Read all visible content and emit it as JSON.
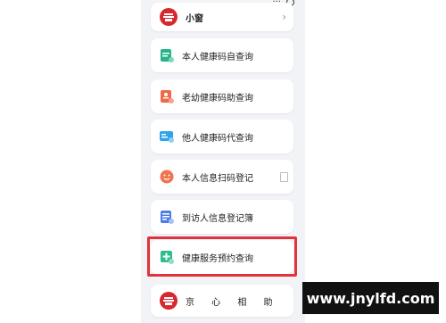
{
  "top_item": {
    "label": "小窗",
    "chevron": "›"
  },
  "menu_items": [
    {
      "label": "本人健康码自查询",
      "icon": "doc-check-icon",
      "color": "#27b38a"
    },
    {
      "label": "老幼健康码助查询",
      "icon": "doc-person-icon",
      "color": "#ee6a4b"
    },
    {
      "label": "他人健康码代查询",
      "icon": "id-card-icon",
      "color": "#2fa4e7"
    },
    {
      "label": "本人信息扫码登记",
      "icon": "smile-icon",
      "color": "#f0744f"
    },
    {
      "label": "到访人信息登记簿",
      "icon": "list-icon",
      "color": "#4d7ce8"
    },
    {
      "label": "健康服务预约查询",
      "icon": "plus-calendar-icon",
      "color": "#2bbd8c"
    }
  ],
  "bottom_item": {
    "label": "京 心 相 助"
  },
  "watermark": "www.jnylfd.com",
  "colors": {
    "highlight": "#e2323b",
    "panel_bg": "#f1f3f7",
    "logo_red": "#d7282f"
  }
}
